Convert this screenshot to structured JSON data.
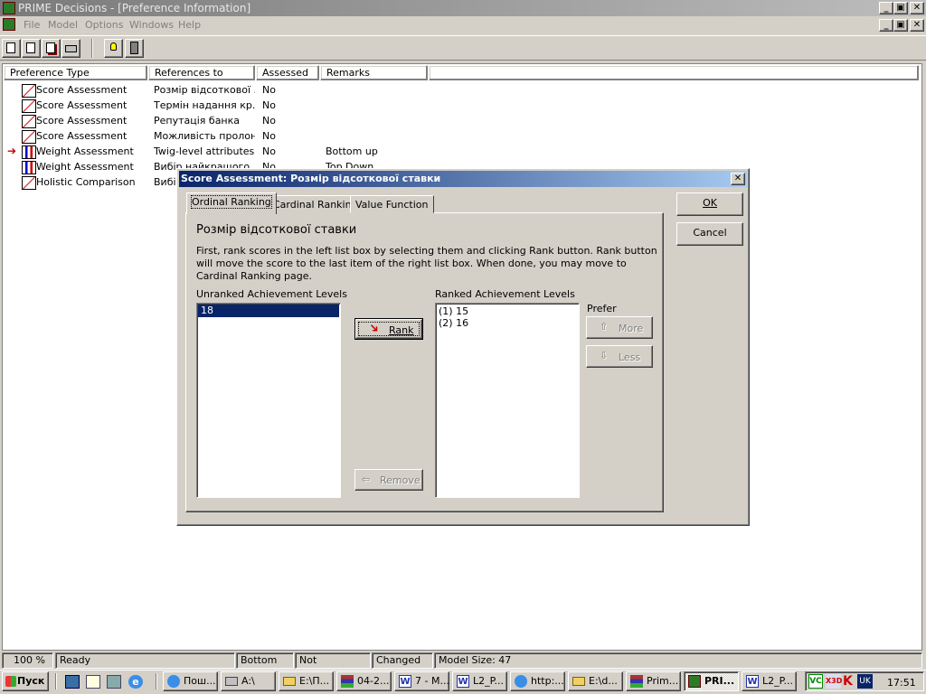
{
  "app": {
    "title": "PRIME Decisions - [Preference Information]",
    "colors": {
      "titlebar": "#0a246a",
      "selection": "#0a246a",
      "face": "#d4d0c8"
    }
  },
  "menu": [
    "File",
    "Model",
    "Options",
    "Windows",
    "Help"
  ],
  "toolbar": [
    "new-icon",
    "open-icon",
    "save-icon",
    "print-icon",
    "bulb-icon",
    "calculator-icon"
  ],
  "table": {
    "columns": [
      "Preference Type",
      "References to",
      "Assessed",
      "Remarks"
    ],
    "rows": [
      {
        "type": "Score Assessment",
        "ref": "Розмір відсоткової ...",
        "assessed": "No",
        "remarks": "",
        "icon": "score-icon"
      },
      {
        "type": "Score Assessment",
        "ref": "Термін надання кр...",
        "assessed": "No",
        "remarks": "",
        "icon": "score-icon"
      },
      {
        "type": "Score Assessment",
        "ref": "Репутація банка",
        "assessed": "No",
        "remarks": "",
        "icon": "score-icon"
      },
      {
        "type": "Score Assessment",
        "ref": "Можливість пролон...",
        "assessed": "No",
        "remarks": "",
        "icon": "score-icon"
      },
      {
        "type": "Weight Assessment",
        "ref": "Twig-level attributes",
        "assessed": "No",
        "remarks": "Bottom up",
        "icon": "weight-icon"
      },
      {
        "type": "Weight Assessment",
        "ref": "Вибір найкращого ...",
        "assessed": "No",
        "remarks": "Top Down",
        "icon": "weight-icon"
      },
      {
        "type": "Holistic Comparison",
        "ref": "Вибір",
        "assessed": "",
        "remarks": "",
        "icon": "score-icon"
      }
    ]
  },
  "dialog": {
    "title": "Score Assessment: Розмір відсоткової ставки",
    "tabs": [
      "Ordinal Ranking",
      "Cardinal Ranking",
      "Value Function"
    ],
    "heading": "Розмір відсоткової ставки",
    "instructions": "First, rank scores in the left list box by selecting them and clicking Rank button. Rank button will move the score to the last item of the right list box. When done, you may move to Cardinal Ranking page.",
    "unranked_label": "Unranked Achievement Levels",
    "unranked": [
      "18"
    ],
    "ranked_label": "Ranked Achievement Levels",
    "ranked": [
      "(1) 15",
      "(2) 16"
    ],
    "rank_btn": "Rank",
    "remove_btn": "Remove",
    "prefer_label": "Prefer",
    "more_btn": "More",
    "less_btn": "Less",
    "ok_btn": "OK",
    "cancel_btn": "Cancel"
  },
  "status": {
    "zoom": "100 %",
    "state": "Ready",
    "direction": "Bottom Up",
    "normalized": "Not normalized",
    "changed": "Changed",
    "model_size": "Model Size: 47"
  },
  "taskbar": {
    "start": "Пуск",
    "tasks": [
      "Пош...",
      "A:\\",
      "E:\\П...",
      "04-2...",
      "7 - M...",
      "L2_P...",
      "http:...",
      "E:\\d...",
      "Prim...",
      "PRI...",
      "L2_P..."
    ],
    "tray_lang": "UK",
    "clock": "17:51"
  }
}
